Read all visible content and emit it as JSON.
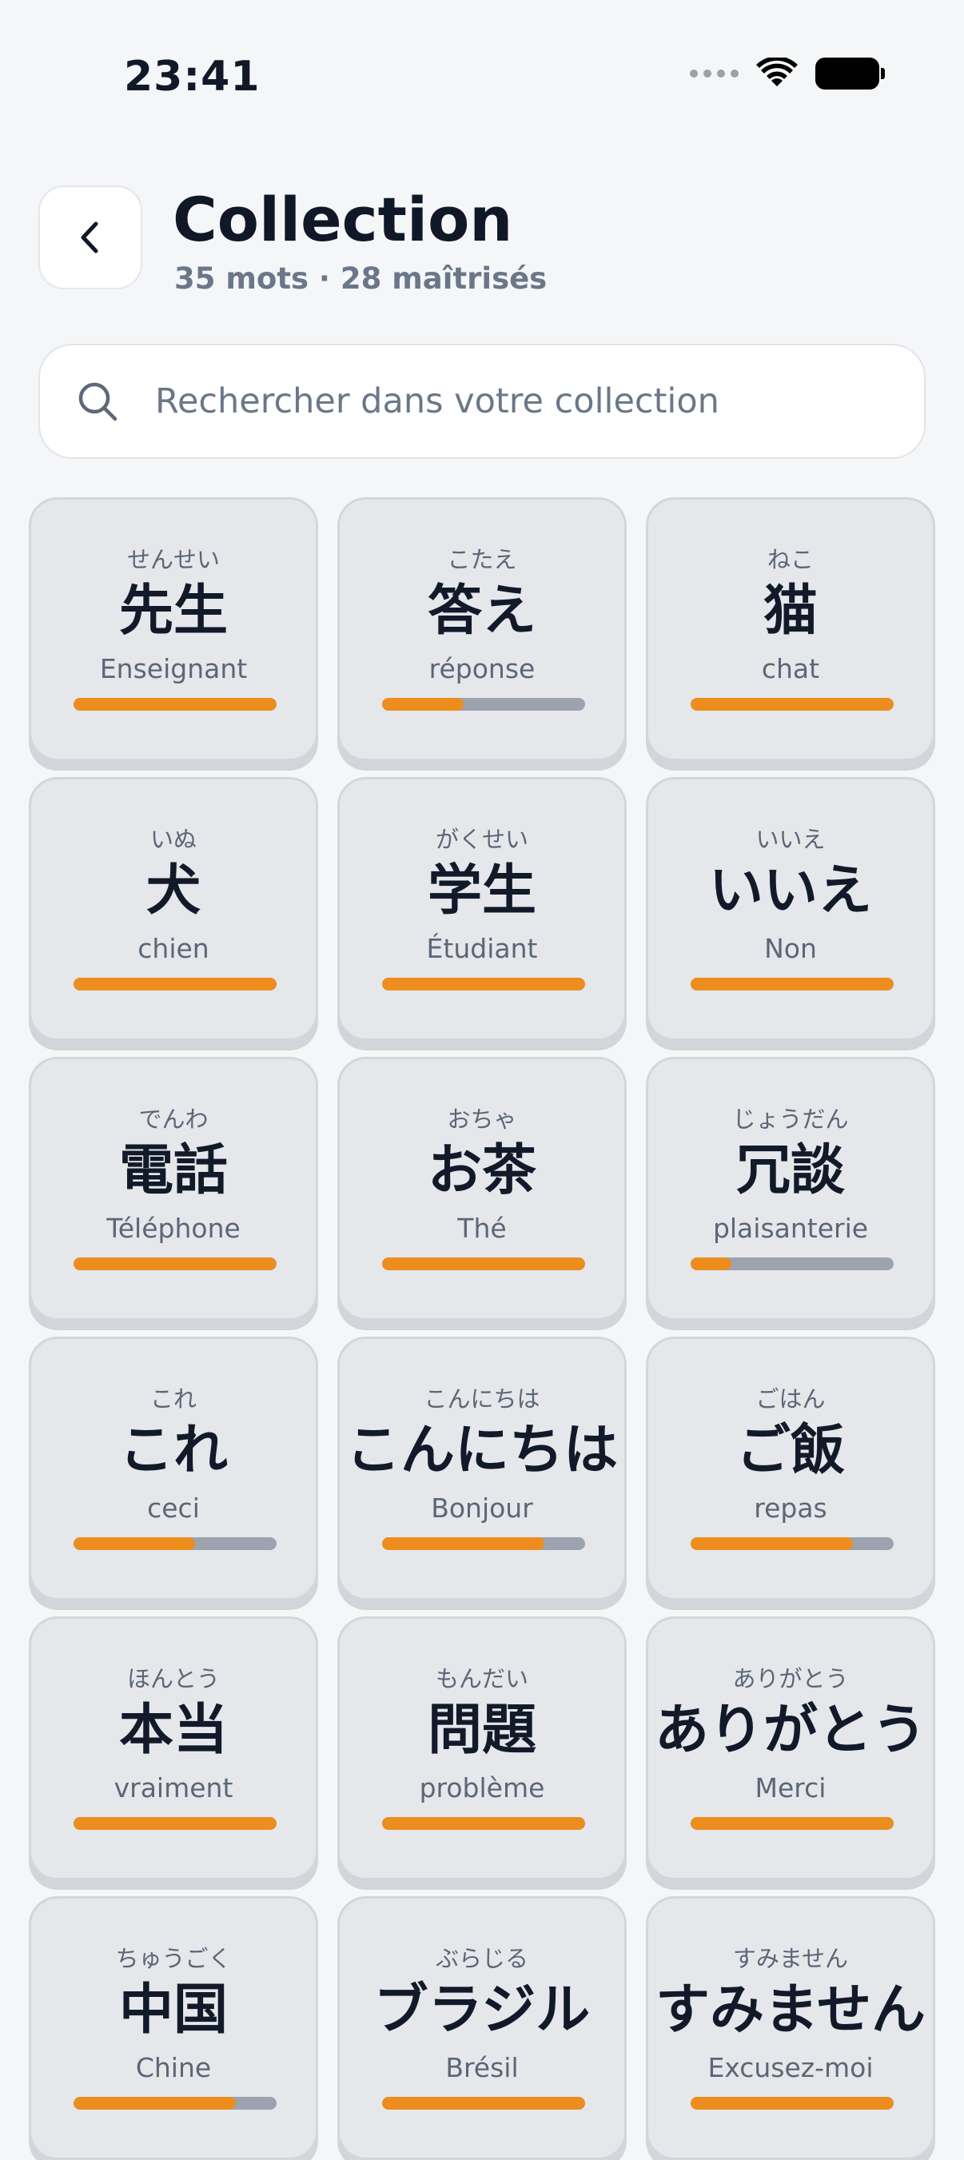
{
  "status_bar": {
    "time": "23:41"
  },
  "header": {
    "back_icon": "chevron-left-icon",
    "title": "Collection",
    "subtitle": "35 mots · 28 maîtrisés"
  },
  "search": {
    "icon": "search-icon",
    "placeholder": "Rechercher dans votre collection",
    "value": ""
  },
  "colors": {
    "accent": "#ec8d1e",
    "track": "#9ca3ae",
    "card_bg": "#e5e7eb"
  },
  "cards": [
    {
      "reading": "せんせい",
      "word": "先生",
      "meaning": "Enseignant",
      "progress": 1.0
    },
    {
      "reading": "こたえ",
      "word": "答え",
      "meaning": "réponse",
      "progress": 0.4
    },
    {
      "reading": "ねこ",
      "word": "猫",
      "meaning": "chat",
      "progress": 1.0
    },
    {
      "reading": "いぬ",
      "word": "犬",
      "meaning": "chien",
      "progress": 1.0
    },
    {
      "reading": "がくせい",
      "word": "学生",
      "meaning": "Étudiant",
      "progress": 1.0
    },
    {
      "reading": "いいえ",
      "word": "いいえ",
      "meaning": "Non",
      "progress": 1.0
    },
    {
      "reading": "でんわ",
      "word": "電話",
      "meaning": "Téléphone",
      "progress": 1.0
    },
    {
      "reading": "おちゃ",
      "word": "お茶",
      "meaning": "Thé",
      "progress": 1.0
    },
    {
      "reading": "じょうだん",
      "word": "冗談",
      "meaning": "plaisanterie",
      "progress": 0.2
    },
    {
      "reading": "これ",
      "word": "これ",
      "meaning": "ceci",
      "progress": 0.6
    },
    {
      "reading": "こんにちは",
      "word": "こんにちは",
      "meaning": "Bonjour",
      "progress": 0.8
    },
    {
      "reading": "ごはん",
      "word": "ご飯",
      "meaning": "repas",
      "progress": 0.8
    },
    {
      "reading": "ほんとう",
      "word": "本当",
      "meaning": "vraiment",
      "progress": 1.0
    },
    {
      "reading": "もんだい",
      "word": "問題",
      "meaning": "problème",
      "progress": 1.0
    },
    {
      "reading": "ありがとう",
      "word": "ありがとう",
      "meaning": "Merci",
      "progress": 1.0
    },
    {
      "reading": "ちゅうごく",
      "word": "中国",
      "meaning": "Chine",
      "progress": 0.8
    },
    {
      "reading": "ぶらじる",
      "word": "ブラジル",
      "meaning": "Brésil",
      "progress": 1.0
    },
    {
      "reading": "すみません",
      "word": "すみません",
      "meaning": "Excusez-moi",
      "progress": 1.0
    }
  ]
}
